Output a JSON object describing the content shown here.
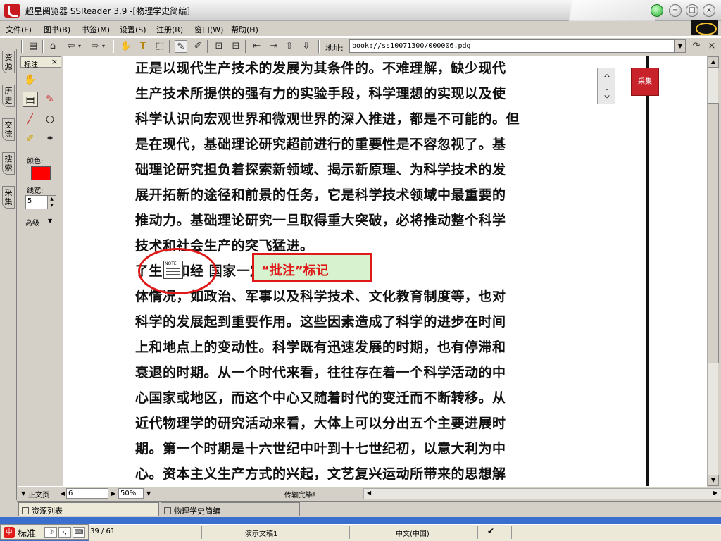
{
  "window": {
    "title": "超星阅览器 SSReader 3.9 -[物理学史简编]",
    "min_icon": "minimize-icon",
    "restore_icon": "restore-icon",
    "close_icon": "close-icon"
  },
  "menu": [
    {
      "label": "文件(F)"
    },
    {
      "label": "图书(B)"
    },
    {
      "label": "书签(M)"
    },
    {
      "label": "设置(S)"
    },
    {
      "label": "注册(R)"
    },
    {
      "label": "窗口(W)"
    },
    {
      "label": "帮助(H)"
    }
  ],
  "toolbar": {
    "address_label": "地址:",
    "address_value": "book://ss10071300/000006.pdg"
  },
  "side_tabs": [
    "资源",
    "历史",
    "交流",
    "搜索",
    "采集"
  ],
  "annotation_panel": {
    "title": "标注",
    "close": "×",
    "color_label": "颜色:",
    "color_value": "#ff0000",
    "linewidth_label": "线宽:",
    "linewidth_value": "5",
    "advanced_label": "高级"
  },
  "document": {
    "lines": [
      "正是以现代生产技术的发展为其条件的。不难理解，缺少现代",
      "生产技术所提供的强有力的实验手段，科学理想的实现以及使",
      "科学认识向宏观世界和微观世界的深入推进，都是不可能的。但",
      "是在现代，基础理论研究超前进行的重要性是不容忽视了。基",
      "础理论研究担负着探索新领域、揭示新原理、为科学技术的发",
      "展开拓新的途径和前景的任务，它是科学技术领域中最重要的",
      "推动力。基础理论研究一旦取得重大突破，必将推动整个科学",
      "技术和社会生产的突飞猛进。",
      "       了生产和经                    国家一定时代所形成的具",
      "体情况，如政治、军事以及科学技术、文化教育制度等，也对",
      "科学的发展起到重要作用。这些因素造成了科学的进步在时间",
      "上和地点上的变动性。科学既有迅速发展的时期，也有停滞和",
      "衰退的时期。从一个时代来看，往往存在着一个科学活动的中",
      "心国家或地区，而这个中心又随着时代的变迁而不断转移。从",
      "近代物理学的研究活动来看，大体上可以分出五个主要进展时",
      "期。第一个时期是十六世纪中叶到十七世纪初，以意大利为中",
      "心。资本主义生产方式的兴起，文艺复兴运动所带来的思想解"
    ],
    "note_icon_label": "NOTE",
    "callout_text": "“批注”标记",
    "badge_text": "采集"
  },
  "doc_status": {
    "view_mode": "正文页",
    "page_value": "6",
    "zoom_value": "50%",
    "status_text": "传输完毕!"
  },
  "bottom_tabs": [
    {
      "label": "资源列表"
    },
    {
      "label": "物理学史简编"
    }
  ],
  "ime": {
    "label": "标准"
  },
  "statusbar": {
    "slide_info": "39 / 61",
    "doc_name": "演示文稿1",
    "language": "中文(中国)"
  }
}
